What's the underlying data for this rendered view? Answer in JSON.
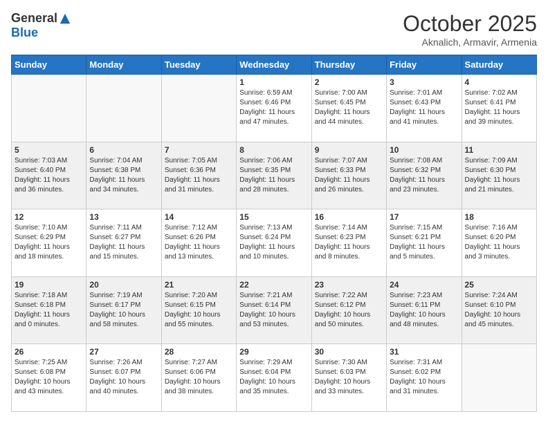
{
  "header": {
    "logo_general": "General",
    "logo_blue": "Blue",
    "month_title": "October 2025",
    "subtitle": "Aknalich, Armavir, Armenia"
  },
  "days_of_week": [
    "Sunday",
    "Monday",
    "Tuesday",
    "Wednesday",
    "Thursday",
    "Friday",
    "Saturday"
  ],
  "weeks": [
    [
      {
        "day": "",
        "info": ""
      },
      {
        "day": "",
        "info": ""
      },
      {
        "day": "",
        "info": ""
      },
      {
        "day": "1",
        "info": "Sunrise: 6:59 AM\nSunset: 6:46 PM\nDaylight: 11 hours\nand 47 minutes."
      },
      {
        "day": "2",
        "info": "Sunrise: 7:00 AM\nSunset: 6:45 PM\nDaylight: 11 hours\nand 44 minutes."
      },
      {
        "day": "3",
        "info": "Sunrise: 7:01 AM\nSunset: 6:43 PM\nDaylight: 11 hours\nand 41 minutes."
      },
      {
        "day": "4",
        "info": "Sunrise: 7:02 AM\nSunset: 6:41 PM\nDaylight: 11 hours\nand 39 minutes."
      }
    ],
    [
      {
        "day": "5",
        "info": "Sunrise: 7:03 AM\nSunset: 6:40 PM\nDaylight: 11 hours\nand 36 minutes."
      },
      {
        "day": "6",
        "info": "Sunrise: 7:04 AM\nSunset: 6:38 PM\nDaylight: 11 hours\nand 34 minutes."
      },
      {
        "day": "7",
        "info": "Sunrise: 7:05 AM\nSunset: 6:36 PM\nDaylight: 11 hours\nand 31 minutes."
      },
      {
        "day": "8",
        "info": "Sunrise: 7:06 AM\nSunset: 6:35 PM\nDaylight: 11 hours\nand 28 minutes."
      },
      {
        "day": "9",
        "info": "Sunrise: 7:07 AM\nSunset: 6:33 PM\nDaylight: 11 hours\nand 26 minutes."
      },
      {
        "day": "10",
        "info": "Sunrise: 7:08 AM\nSunset: 6:32 PM\nDaylight: 11 hours\nand 23 minutes."
      },
      {
        "day": "11",
        "info": "Sunrise: 7:09 AM\nSunset: 6:30 PM\nDaylight: 11 hours\nand 21 minutes."
      }
    ],
    [
      {
        "day": "12",
        "info": "Sunrise: 7:10 AM\nSunset: 6:29 PM\nDaylight: 11 hours\nand 18 minutes."
      },
      {
        "day": "13",
        "info": "Sunrise: 7:11 AM\nSunset: 6:27 PM\nDaylight: 11 hours\nand 15 minutes."
      },
      {
        "day": "14",
        "info": "Sunrise: 7:12 AM\nSunset: 6:26 PM\nDaylight: 11 hours\nand 13 minutes."
      },
      {
        "day": "15",
        "info": "Sunrise: 7:13 AM\nSunset: 6:24 PM\nDaylight: 11 hours\nand 10 minutes."
      },
      {
        "day": "16",
        "info": "Sunrise: 7:14 AM\nSunset: 6:23 PM\nDaylight: 11 hours\nand 8 minutes."
      },
      {
        "day": "17",
        "info": "Sunrise: 7:15 AM\nSunset: 6:21 PM\nDaylight: 11 hours\nand 5 minutes."
      },
      {
        "day": "18",
        "info": "Sunrise: 7:16 AM\nSunset: 6:20 PM\nDaylight: 11 hours\nand 3 minutes."
      }
    ],
    [
      {
        "day": "19",
        "info": "Sunrise: 7:18 AM\nSunset: 6:18 PM\nDaylight: 11 hours\nand 0 minutes."
      },
      {
        "day": "20",
        "info": "Sunrise: 7:19 AM\nSunset: 6:17 PM\nDaylight: 10 hours\nand 58 minutes."
      },
      {
        "day": "21",
        "info": "Sunrise: 7:20 AM\nSunset: 6:15 PM\nDaylight: 10 hours\nand 55 minutes."
      },
      {
        "day": "22",
        "info": "Sunrise: 7:21 AM\nSunset: 6:14 PM\nDaylight: 10 hours\nand 53 minutes."
      },
      {
        "day": "23",
        "info": "Sunrise: 7:22 AM\nSunset: 6:12 PM\nDaylight: 10 hours\nand 50 minutes."
      },
      {
        "day": "24",
        "info": "Sunrise: 7:23 AM\nSunset: 6:11 PM\nDaylight: 10 hours\nand 48 minutes."
      },
      {
        "day": "25",
        "info": "Sunrise: 7:24 AM\nSunset: 6:10 PM\nDaylight: 10 hours\nand 45 minutes."
      }
    ],
    [
      {
        "day": "26",
        "info": "Sunrise: 7:25 AM\nSunset: 6:08 PM\nDaylight: 10 hours\nand 43 minutes."
      },
      {
        "day": "27",
        "info": "Sunrise: 7:26 AM\nSunset: 6:07 PM\nDaylight: 10 hours\nand 40 minutes."
      },
      {
        "day": "28",
        "info": "Sunrise: 7:27 AM\nSunset: 6:06 PM\nDaylight: 10 hours\nand 38 minutes."
      },
      {
        "day": "29",
        "info": "Sunrise: 7:29 AM\nSunset: 6:04 PM\nDaylight: 10 hours\nand 35 minutes."
      },
      {
        "day": "30",
        "info": "Sunrise: 7:30 AM\nSunset: 6:03 PM\nDaylight: 10 hours\nand 33 minutes."
      },
      {
        "day": "31",
        "info": "Sunrise: 7:31 AM\nSunset: 6:02 PM\nDaylight: 10 hours\nand 31 minutes."
      },
      {
        "day": "",
        "info": ""
      }
    ]
  ]
}
